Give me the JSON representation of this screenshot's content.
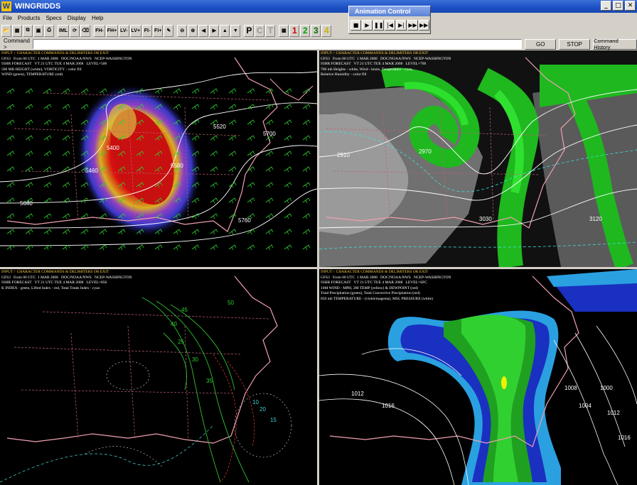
{
  "window": {
    "title": "WINGRIDDS",
    "logo": "W"
  },
  "menu": [
    "File",
    "Products",
    "Specs",
    "Display",
    "Help"
  ],
  "toolbar": {
    "tools": [
      "IML",
      "FH-",
      "FH+",
      "LV-",
      "LV+",
      "FI-",
      "FI+",
      "P",
      "C",
      "T"
    ],
    "numbers": [
      "1",
      "2",
      "3",
      "4"
    ],
    "number_colors": [
      "#cc0000",
      "#00a000",
      "#007000",
      "#c8b400"
    ]
  },
  "animation": {
    "title": "Animation Control"
  },
  "command": {
    "label": "Command >",
    "value": "",
    "go": "GO",
    "stop": "STOP",
    "history": "Command History"
  },
  "panels": [
    {
      "cmd": "INPUT ↑ CHARACTER COMMANDS & DELIMITERS OR EXIT",
      "lines": [
        "GFS3   From 00 UTC  1 MAR 2008   DOC/NOAA/NWS   NCEP-WASHINGTON",
        "93HR FORECAST   VT 21 UTC TUE 4 MAR 2008   LEVEL=500",
        "500 MB HEIGHT (white), VORTICITY - color fill",
        "WIND (green), TEMPERATURE (red)"
      ],
      "contours": [
        "5400",
        "5460",
        "5640",
        "5700",
        "5760",
        "5580",
        "5520"
      ]
    },
    {
      "cmd": "INPUT ↑ CHARACTER COMMANDS & DELIMITERS OR EXIT",
      "lines": [
        "GFS3   From 00 UTC  1 MAR 2008   DOC/NOAA/NWS   NCEP-WASHINGTON",
        "93HR FORECAST   VT 21 UTC TUE 4 MAR 2008   LEVEL=700",
        "700 mb Heights - white, Wind - knots, Temperature - cyan,",
        "Relative Humidity - color fill"
      ],
      "contours": [
        "2910",
        "2970",
        "3030",
        "3120"
      ]
    },
    {
      "cmd": "INPUT ↑ CHARACTER COMMANDS & DELIMITERS OR EXIT",
      "lines": [
        "GFS3   From 00 UTC  1 MAR 2008   DOC/NOAA/NWS   NCEP-WASHINGTON",
        "93HR FORECAST   VT 21 UTC TUE 4 MAR 2008   LEVEL=850",
        "K INDEX - green, Lifted Index - red, Total Totals Index - cyan"
      ],
      "contours": [
        "25",
        "30",
        "35",
        "40",
        "45",
        "50",
        "20",
        "15",
        "10"
      ]
    },
    {
      "cmd": "INPUT ↑ CHARACTER COMMANDS & DELIMITERS OR EXIT",
      "lines": [
        "GFS3   From 00 UTC  1 MAR 2008   DOC/NOAA/NWS   NCEP-WASHINGTON",
        "93HR FORECAST   VT 21 UTC TUE 4 MAR 2008   LEVEL=SFC",
        "10M WIND - MPH, 2M TEMP (yellow) & DEWPOINT (red)",
        "Total Precipitation (green), Total Convective Precipitation (red)",
        "850 mb TEMPERATURE - (violet/magenta), MSL PRESSURE (white)"
      ],
      "contours": [
        "1012",
        "1016",
        "1008",
        "1004",
        "1000",
        "1012",
        "1016"
      ]
    }
  ]
}
